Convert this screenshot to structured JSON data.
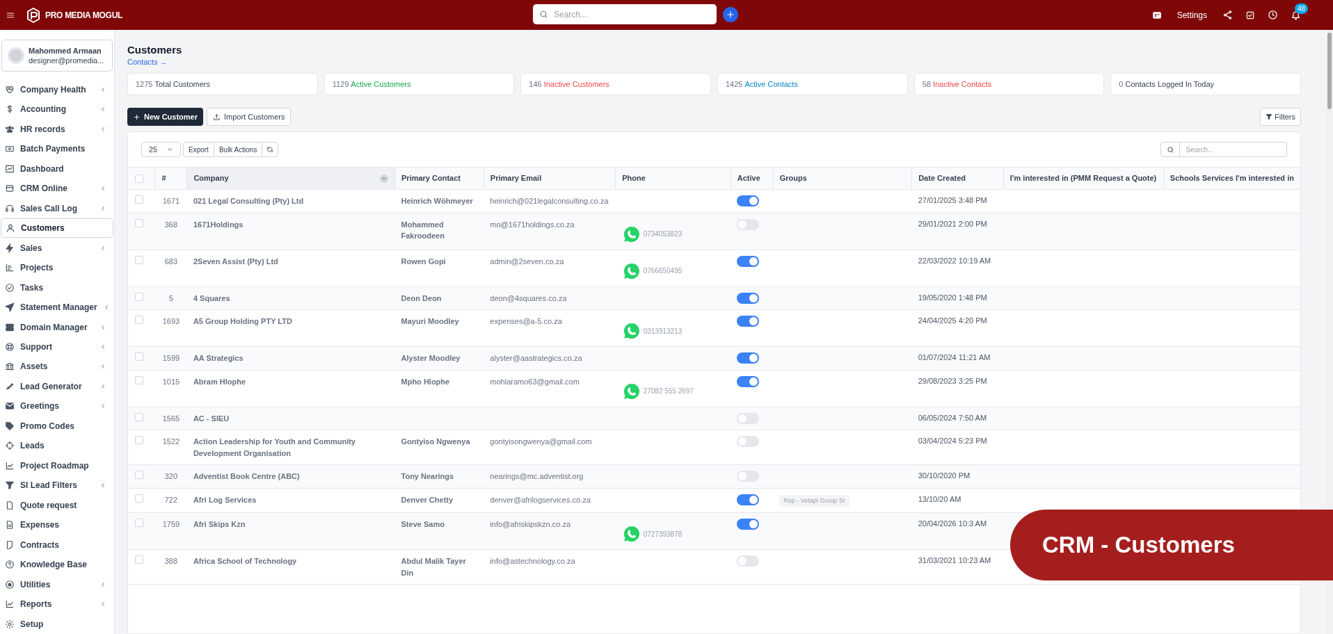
{
  "header": {
    "brand": "PRO MEDIA MOGUL",
    "search_placeholder": "Search...",
    "settings": "Settings",
    "notification_count": "48"
  },
  "user": {
    "name": "Mahommed Armaan",
    "email": "designer@promedia..."
  },
  "sidebar": {
    "items": [
      {
        "label": "Company Health",
        "has_children": true,
        "selected": false
      },
      {
        "label": "Accounting",
        "has_children": true,
        "selected": false
      },
      {
        "label": "HR records",
        "has_children": true,
        "selected": false
      },
      {
        "label": "Batch Payments",
        "has_children": false,
        "selected": false
      },
      {
        "label": "Dashboard",
        "has_children": false,
        "selected": false
      },
      {
        "label": "CRM Online",
        "has_children": true,
        "selected": false
      },
      {
        "label": "Sales Call Log",
        "has_children": true,
        "selected": false
      },
      {
        "label": "Customers",
        "has_children": false,
        "selected": true
      },
      {
        "label": "Sales",
        "has_children": true,
        "selected": false
      },
      {
        "label": "Projects",
        "has_children": false,
        "selected": false
      },
      {
        "label": "Tasks",
        "has_children": false,
        "selected": false
      },
      {
        "label": "Statement Manager",
        "has_children": true,
        "selected": false
      },
      {
        "label": "Domain Manager",
        "has_children": true,
        "selected": false
      },
      {
        "label": "Support",
        "has_children": true,
        "selected": false
      },
      {
        "label": "Assets",
        "has_children": true,
        "selected": false
      },
      {
        "label": "Lead Generator",
        "has_children": true,
        "selected": false
      },
      {
        "label": "Greetings",
        "has_children": true,
        "selected": false
      },
      {
        "label": "Promo Codes",
        "has_children": false,
        "selected": false
      },
      {
        "label": "Leads",
        "has_children": false,
        "selected": false
      },
      {
        "label": "Project Roadmap",
        "has_children": false,
        "selected": false
      },
      {
        "label": "SI Lead Filters",
        "has_children": true,
        "selected": false
      },
      {
        "label": "Quote request",
        "has_children": false,
        "selected": false
      },
      {
        "label": "Expenses",
        "has_children": false,
        "selected": false
      },
      {
        "label": "Contracts",
        "has_children": false,
        "selected": false
      },
      {
        "label": "Knowledge Base",
        "has_children": false,
        "selected": false
      },
      {
        "label": "Utilities",
        "has_children": true,
        "selected": false
      },
      {
        "label": "Reports",
        "has_children": true,
        "selected": false
      },
      {
        "label": "Setup",
        "has_children": false,
        "selected": false
      }
    ]
  },
  "page": {
    "title": "Customers",
    "link": "Contacts →"
  },
  "stats": [
    {
      "count": "1275",
      "label": "Total Customers",
      "color": "#374151"
    },
    {
      "count": "1129",
      "label": "Active Customers",
      "color": "#16a34a"
    },
    {
      "count": "146",
      "label": "Inactive Customers",
      "color": "#ef4444"
    },
    {
      "count": "1425",
      "label": "Active Contacts",
      "color": "#0284c7"
    },
    {
      "count": "58",
      "label": "Inactive Contacts",
      "color": "#ef4444"
    },
    {
      "count": "0",
      "label": "Contacts Logged In Today",
      "color": "#374151"
    }
  ],
  "actions": {
    "new": "New Customer",
    "import": "Import Customers",
    "filters": "Filters"
  },
  "table": {
    "select_all_checked": false,
    "page_size": "25",
    "export": "Export",
    "bulk": "Bulk Actions",
    "search_placeholder": "Search...",
    "columns": [
      "#",
      "Company",
      "Primary Contact",
      "Primary Email",
      "Phone",
      "Active",
      "Groups",
      "Date Created",
      "I'm interested in (PMM Request a Quote)",
      "Schools Services I'm interested in"
    ],
    "rows": [
      {
        "checked": false,
        "id": "1671",
        "company": "021 Legal Consulting (Pty) Ltd",
        "contact": "Heinrich Wöhmeyer",
        "email": "heinrich@021legalconsulting.co.za",
        "active": true,
        "date": "27/01/2025 3:48 PM"
      },
      {
        "checked": false,
        "id": "368",
        "company": "1671Holdings",
        "contact": "Mohammed Fakroodeen",
        "email": "mo@1671holdings.co.za",
        "phone": "0734053823",
        "active": false,
        "date": "29/01/2021 2:00 PM"
      },
      {
        "checked": false,
        "id": "683",
        "company": "2Seven Assist (Pty) Ltd",
        "contact": "Rowen Gopi",
        "email": "admin@2seven.co.za",
        "phone": "0766650495",
        "active": true,
        "date": "22/03/2022 10:19 AM"
      },
      {
        "checked": false,
        "id": "5",
        "company": "4 Squares",
        "contact": "Deon Deon",
        "email": "deon@4squares.co.za",
        "active": true,
        "date": "19/05/2020 1:48 PM"
      },
      {
        "checked": false,
        "id": "1693",
        "company": "A5 Group Holding PTY LTD",
        "contact": "Mayuri Moodley",
        "email": "expenses@a-5.co.za",
        "phone": "0313913213",
        "active": true,
        "date": "24/04/2025 4:20 PM"
      },
      {
        "checked": false,
        "id": "1599",
        "company": "AA Strategics",
        "contact": "Alyster Moodley",
        "email": "alyster@aastrategics.co.za",
        "active": true,
        "date": "01/07/2024 11:21 AM"
      },
      {
        "checked": false,
        "id": "1015",
        "company": "Abram Hlophe",
        "contact": "Mpho Hlophe",
        "email": "mohlaramo63@gmail.com",
        "phone": "27082 555 2697",
        "active": true,
        "date": "29/08/2023 3:25 PM"
      },
      {
        "checked": false,
        "id": "1565",
        "company": "AC - SIEU",
        "active": false,
        "date": "06/05/2024 7:50 AM"
      },
      {
        "checked": false,
        "id": "1522",
        "company": "Action Leadership for Youth and Community Development Organisation",
        "contact": "Gontyiso Ngwenya",
        "email": "gontyisongwenya@gmail.com",
        "active": false,
        "date": "03/04/2024 5:23 PM"
      },
      {
        "checked": false,
        "id": "320",
        "company": "Adventist Book Centre (ABC)",
        "contact": "Tony Nearings",
        "email": "nearings@mc.adventist.org",
        "active": false,
        "date": "30/10/2020 PM"
      },
      {
        "checked": false,
        "id": "722",
        "company": "Afri Log Services",
        "contact": "Denver Chetty",
        "email": "denver@afrilogservices.co.za",
        "active": true,
        "group": "Rep - Vetapi Group Sr",
        "date": "13/10/20 AM"
      },
      {
        "checked": false,
        "id": "1759",
        "company": "Afri Skips Kzn",
        "contact": "Steve Samo",
        "email": "info@afriskipskzn.co.za",
        "phone": "0727393878",
        "active": true,
        "date": "20/04/2026 10:3 AM"
      },
      {
        "checked": false,
        "id": "388",
        "company": "Africa School of Technology",
        "contact": "Abdul Malik Tayer Din",
        "email": "info@astechnology.co.za",
        "active": false,
        "date": "31/03/2021 10:23 AM"
      }
    ]
  },
  "banner": {
    "text": "CRM - Customers"
  }
}
